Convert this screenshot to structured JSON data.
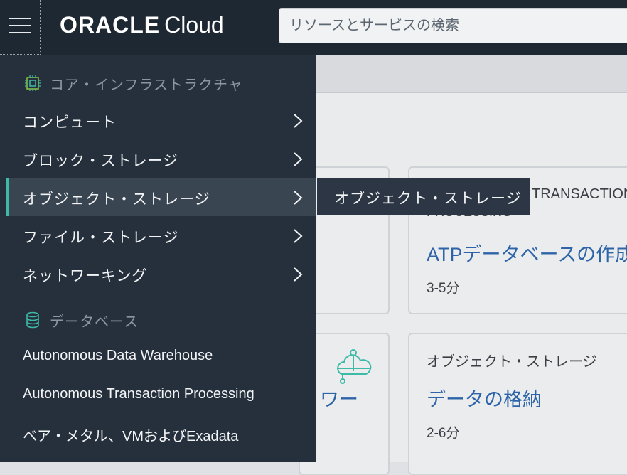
{
  "header": {
    "brand": "ORACLE",
    "product": "Cloud",
    "search_placeholder": "リソースとサービスの検索"
  },
  "background_cards": [
    {
      "category_partial": "TRANSACTION",
      "category_partial_line2": "PROCESSING",
      "title": "ATPデータベースの作成",
      "time": "3-5分"
    },
    {
      "title_partial": "ワー"
    },
    {
      "category": "オブジェクト・ストレージ",
      "title": "データの格納",
      "time": "2-6分"
    }
  ],
  "side_menu": {
    "sections": [
      {
        "header": "コア・インフラストラクチャ",
        "icon": "chip-icon",
        "items": [
          {
            "label": "コンピュート",
            "has_submenu": true
          },
          {
            "label": "ブロック・ストレージ",
            "has_submenu": true
          },
          {
            "label": "オブジェクト・ストレージ",
            "has_submenu": true,
            "active": true
          },
          {
            "label": "ファイル・ストレージ",
            "has_submenu": true
          },
          {
            "label": "ネットワーキング",
            "has_submenu": true
          }
        ]
      },
      {
        "header": "データベース",
        "icon": "database-icon",
        "items": [
          {
            "label": "Autonomous Data Warehouse"
          },
          {
            "label": "Autonomous Transaction Processing"
          },
          {
            "label": "ベア・メタル、VMおよびExadata"
          }
        ]
      }
    ]
  },
  "flyout": {
    "items": [
      "オブジェクト・ストレージ"
    ]
  },
  "colors": {
    "header_bg": "#1e2833",
    "menu_bg": "#26303c",
    "active_bg": "#3a4552",
    "accent": "#3ebba6",
    "link_blue": "#2d64a8"
  }
}
